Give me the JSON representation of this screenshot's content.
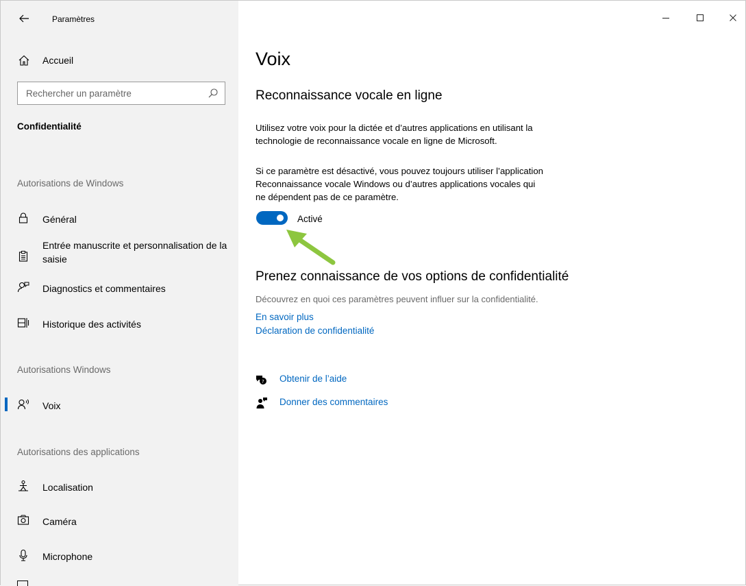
{
  "window": {
    "title": "Paramètres",
    "controls": {
      "minimize": "—",
      "maximize": "☐",
      "close": "✕"
    }
  },
  "sidebar": {
    "home_label": "Accueil",
    "search_placeholder": "Rechercher un paramètre",
    "section_title": "Confidentialité",
    "groups": [
      {
        "header": "Autorisations de Windows"
      },
      {
        "header": "Autorisations Windows"
      },
      {
        "header": "Autorisations des applications"
      }
    ],
    "items": [
      {
        "label": "Général",
        "icon": "lock-icon"
      },
      {
        "label": "Entrée manuscrite et personnalisation de la saisie",
        "icon": "clipboard-icon"
      },
      {
        "label": "Diagnostics et commentaires",
        "icon": "feedback-person-icon"
      },
      {
        "label": "Historique des activités",
        "icon": "timeline-icon"
      },
      {
        "label": "Voix",
        "icon": "speech-icon",
        "selected": true
      },
      {
        "label": "Localisation",
        "icon": "location-person-icon"
      },
      {
        "label": "Caméra",
        "icon": "camera-icon"
      },
      {
        "label": "Microphone",
        "icon": "microphone-icon"
      }
    ]
  },
  "main": {
    "title": "Voix",
    "section_heading": "Reconnaissance vocale en ligne",
    "desc1_line1": "Utilisez votre voix pour la dictée et d’autres applications en utilisant la",
    "desc1_line2": "technologie de reconnaissance vocale en ligne de Microsoft.",
    "desc2_line1": "Si ce paramètre est désactivé, vous pouvez toujours utiliser l’application",
    "desc2_line2": "Reconnaissance vocale Windows ou d’autres applications vocales qui",
    "desc2_line3": "ne dépendent pas de ce paramètre.",
    "toggle": {
      "state": "on",
      "label": "Activé"
    },
    "privacy": {
      "heading": "Prenez connaissance de vos options de confidentialité",
      "description": "Découvrez en quoi ces paramètres peuvent influer sur la confidentialité.",
      "links": [
        "En savoir plus",
        "Déclaration de confidentialité"
      ]
    },
    "help": {
      "get_help": "Obtenir de l’aide",
      "feedback": "Donner des commentaires"
    }
  },
  "colors": {
    "accent": "#0067c0",
    "sidebar_bg": "#f2f2f2",
    "annotation_arrow": "#8dc63f"
  }
}
